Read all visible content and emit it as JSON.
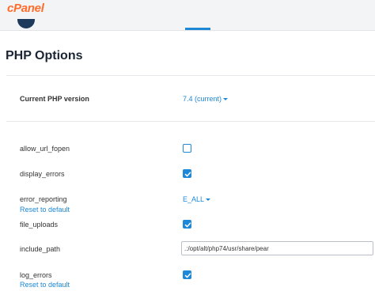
{
  "header": {
    "logo_text": "cPanel"
  },
  "page": {
    "title": "PHP Options"
  },
  "version": {
    "label": "Current PHP version",
    "value": "7.4 (current)"
  },
  "options": {
    "allow_url_fopen": {
      "label": "allow_url_fopen",
      "checked": false
    },
    "display_errors": {
      "label": "display_errors",
      "checked": true
    },
    "error_reporting": {
      "label": "error_reporting",
      "value": "E_ALL",
      "reset_label": "Reset to default"
    },
    "file_uploads": {
      "label": "file_uploads",
      "checked": true
    },
    "include_path": {
      "label": "include_path",
      "value": ".:/opt/alt/php74/usr/share/pear"
    },
    "log_errors": {
      "label": "log_errors",
      "checked": true,
      "reset_label": "Reset to default"
    }
  },
  "colors": {
    "accent": "#1e88d6",
    "brand": "#ff6c2c",
    "title": "#1b2533"
  },
  "icons": {
    "checkbox_checked": "check-icon",
    "dropdown": "caret-down-icon"
  }
}
